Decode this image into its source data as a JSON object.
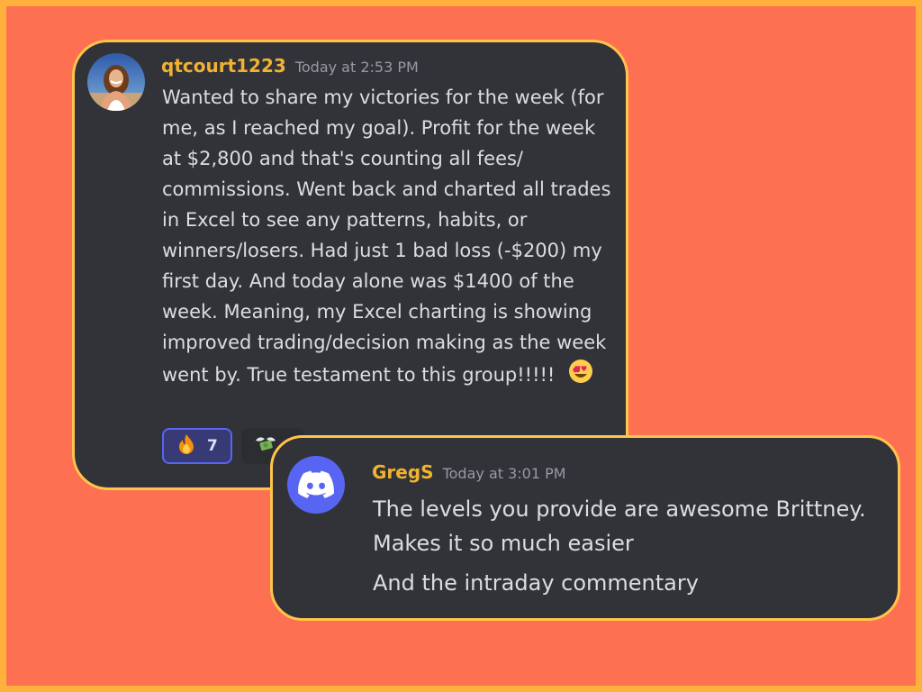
{
  "colors": {
    "background": "#fd7152",
    "frame_border": "#ffb13b",
    "card_border": "#ffc44a",
    "card_bg": "#313338",
    "username": "#f0b232",
    "discord_blurple": "#5865f2"
  },
  "message1": {
    "username": "qtcourt1223",
    "timestamp": "Today at 2:53 PM",
    "avatar_icon": "user-photo-avatar",
    "text": "Wanted to share my victories for the week (for me, as I reached my goal).  Profit for the week at $2,800 and that's counting all fees/ commissions.  Went back and charted all trades in Excel to see any patterns, habits, or winners/losers.  Had just 1 bad loss (-$200) my first day.  And today alone was $1400 of the week.  Meaning, my Excel charting is showing improved trading/decision making as the week went by.  True testament to this group!!!!!",
    "trailing_emoji": "heart-eyes-emoji",
    "reactions": [
      {
        "icon": "fire-emoji",
        "count": "7"
      },
      {
        "icon": "money-with-wings-emoji",
        "count": ""
      }
    ]
  },
  "message2": {
    "username": "GregS",
    "timestamp": "Today at 3:01 PM",
    "avatar_icon": "discord-logo-icon",
    "line1": "The levels you provide are awesome Brittney.",
    "line2": "Makes it so much easier",
    "line3": "And the intraday commentary"
  }
}
